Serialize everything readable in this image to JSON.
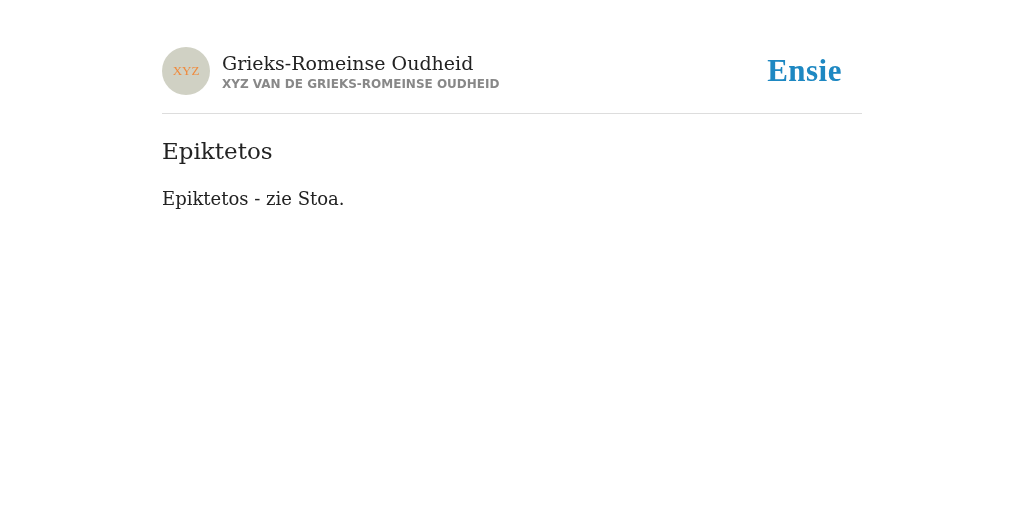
{
  "header": {
    "avatar_text": "XYZ",
    "title": "Grieks-Romeinse Oudheid",
    "subtitle": "XYZ VAN DE GRIEKS-ROMEINSE OUDHEID",
    "logo": "Ensie"
  },
  "article": {
    "title": "Epiktetos",
    "body": "Epiktetos - zie Stoa."
  }
}
